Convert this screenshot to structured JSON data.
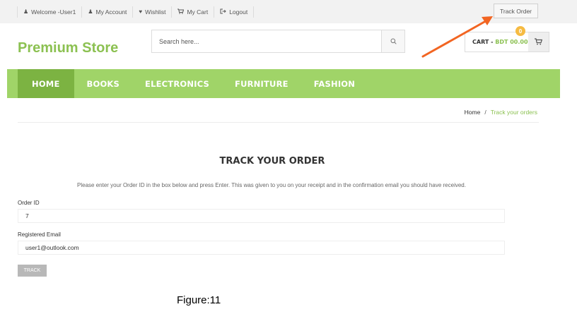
{
  "topbar": {
    "links": [
      {
        "icon": "user-icon",
        "label": "Welcome -User1"
      },
      {
        "icon": "user-icon",
        "label": "My Account"
      },
      {
        "icon": "heart-icon",
        "label": "Wishlist"
      },
      {
        "icon": "cart-icon",
        "label": "My Cart"
      },
      {
        "icon": "logout-icon",
        "label": "Logout"
      }
    ],
    "track_order": "Track Order"
  },
  "header": {
    "logo": "Premium Store",
    "search_placeholder": "Search here...",
    "cart_label": "CART - ",
    "cart_amount": "BDT 00.00",
    "cart_count": "0"
  },
  "nav": {
    "items": [
      "HOME",
      "BOOKS",
      "ELECTRONICS",
      "FURNITURE",
      "FASHION"
    ],
    "active": "HOME"
  },
  "breadcrumb": {
    "home": "Home",
    "separator": "/",
    "current": "Track your orders"
  },
  "track": {
    "title": "TRACK YOUR ORDER",
    "intro": "Please enter your Order ID in the box below and press Enter. This was given to you on your receipt and in the confirmation email you should have received.",
    "order_id_label": "Order ID",
    "order_id_value": "7",
    "email_label": "Registered Email",
    "email_value": "user1@outlook.com",
    "button": "TRACK"
  },
  "caption": "Figure:11",
  "colors": {
    "accent_green": "#8cc152",
    "nav_green": "#a0d468",
    "nav_active": "#7cb342",
    "arrow_orange": "#f26522",
    "badge_yellow": "#f6bb42"
  }
}
